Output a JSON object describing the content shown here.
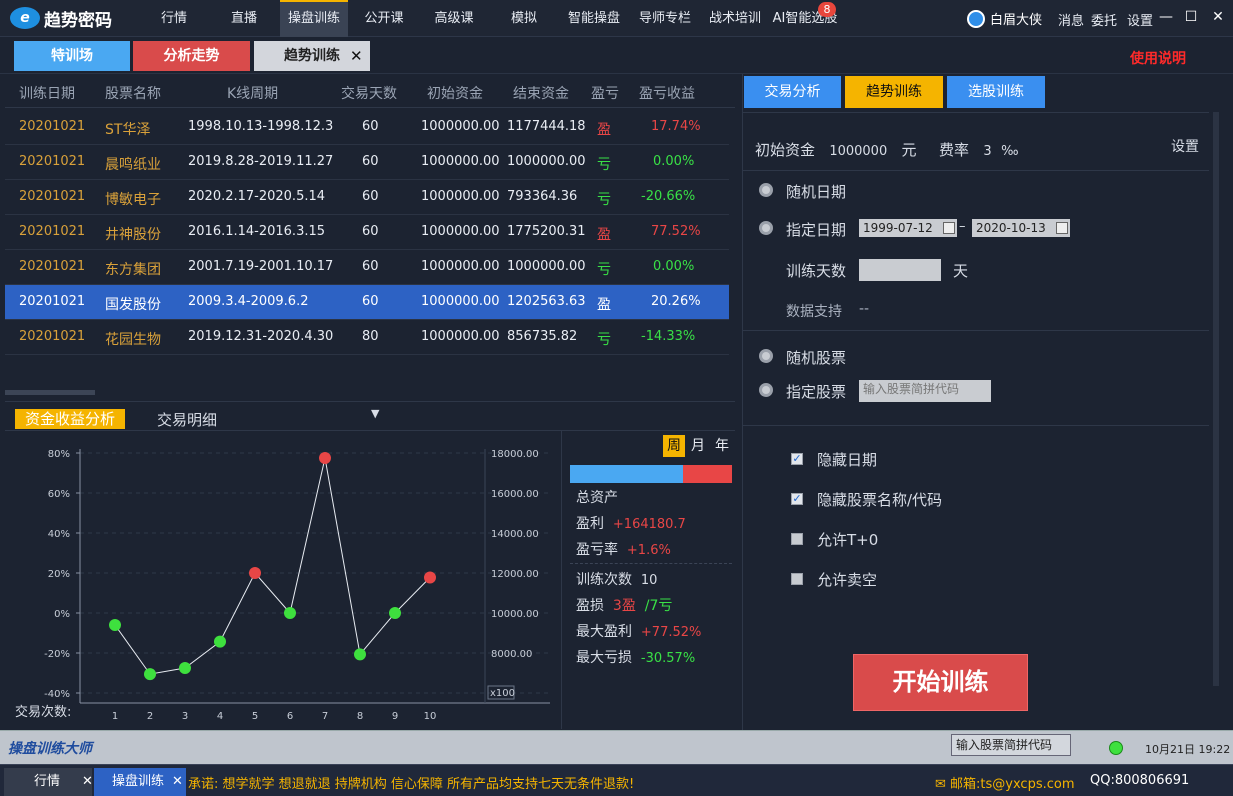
{
  "app": {
    "logo_text": "趋势密码",
    "logo_mark": "e"
  },
  "nav": [
    {
      "label": "行情"
    },
    {
      "label": "直播"
    },
    {
      "label": "操盘训练"
    },
    {
      "label": "公开课"
    },
    {
      "label": "高级课"
    },
    {
      "label": "模拟"
    },
    {
      "label": "智能操盘"
    },
    {
      "label": "导师专栏"
    },
    {
      "label": "战术培训"
    },
    {
      "label": "AI智能选股"
    }
  ],
  "nav_badge": "8",
  "user": {
    "name": "白眉大侠"
  },
  "top_links": {
    "msg": "消息",
    "entrust": "委托",
    "settings": "设置"
  },
  "window_controls": {
    "min": "—",
    "max": "☐",
    "close": "✕"
  },
  "main_tabs": {
    "tab1": "特训场",
    "tab2": "分析走势",
    "tab3": "趋势训练",
    "tab3_close": "✕"
  },
  "help_link": "使用说明",
  "table": {
    "headers": [
      "训练日期",
      "股票名称",
      "K线周期",
      "交易天数",
      "初始资金",
      "结束资金",
      "盈亏",
      "盈亏收益"
    ],
    "rows": [
      {
        "date": "20201021",
        "name": "ST华泽",
        "period": "1998.10.13-1998.12.3",
        "days": "60",
        "init": "1000000.00",
        "end": "1177444.18",
        "pl": "盈",
        "ret": "17.74%"
      },
      {
        "date": "20201021",
        "name": "晨鸣纸业",
        "period": "2019.8.28-2019.11.27",
        "days": "60",
        "init": "1000000.00",
        "end": "1000000.00",
        "pl": "亏",
        "ret": "0.00%"
      },
      {
        "date": "20201021",
        "name": "博敏电子",
        "period": "2020.2.17-2020.5.14",
        "days": "60",
        "init": "1000000.00",
        "end": "793364.36",
        "pl": "亏",
        "ret": "-20.66%"
      },
      {
        "date": "20201021",
        "name": "井神股份",
        "period": "2016.1.14-2016.3.15",
        "days": "60",
        "init": "1000000.00",
        "end": "1775200.31",
        "pl": "盈",
        "ret": "77.52%"
      },
      {
        "date": "20201021",
        "name": "东方集团",
        "period": "2001.7.19-2001.10.17",
        "days": "60",
        "init": "1000000.00",
        "end": "1000000.00",
        "pl": "亏",
        "ret": "0.00%"
      },
      {
        "date": "20201021",
        "name": "国发股份",
        "period": "2009.3.4-2009.6.2",
        "days": "60",
        "init": "1000000.00",
        "end": "1202563.63",
        "pl": "盈",
        "ret": "20.26%"
      },
      {
        "date": "20201021",
        "name": "花园生物",
        "period": "2019.12.31-2020.4.30",
        "days": "80",
        "init": "1000000.00",
        "end": "856735.82",
        "pl": "亏",
        "ret": "-14.33%"
      }
    ]
  },
  "subtabs": {
    "tab1": "资金收益分析",
    "tab2": "交易明细",
    "arrow": "▼"
  },
  "chart_data": {
    "type": "line",
    "xlabel": "交易次数:",
    "x": [
      1,
      2,
      3,
      4,
      5,
      6,
      7,
      8,
      9,
      10
    ],
    "series": [
      {
        "values": [
          -6,
          -30.57,
          -27.5,
          -14.33,
          20,
          0,
          77.52,
          -20.66,
          0,
          17.74
        ]
      }
    ],
    "y_left_ticks": [
      "80%",
      "60%",
      "40%",
      "20%",
      "0%",
      "-20%",
      "-40%"
    ],
    "y_right_ticks": [
      "18000.00",
      "16000.00",
      "14000.00",
      "12000.00",
      "10000.00",
      "8000.00"
    ],
    "right_unit": "x100",
    "ylim": [
      -40,
      80
    ],
    "colors": {
      "pos": "#e84646",
      "neg": "#3ee03e"
    }
  },
  "period_buttons": {
    "week": "周",
    "month": "月",
    "year": "年"
  },
  "stats": {
    "bar_win_fraction": 0.7,
    "total_assets": "总资产",
    "profit_label": "盈利",
    "profit": "+164180.7",
    "rate_label": "盈亏率",
    "rate": "+1.6%",
    "count_label": "训练次数",
    "count": "10",
    "wl_label": "盈损",
    "wins": "3盈",
    "losses": "/7亏",
    "max_profit_label": "最大盈利",
    "max_profit": "+77.52%",
    "max_loss_label": "最大亏损",
    "max_loss": "-30.57%"
  },
  "right_tabs": {
    "t1": "交易分析",
    "t2": "趋势训练",
    "t3": "选股训练"
  },
  "settings": {
    "capital_label": "初始资金",
    "capital": "1000000",
    "capital_unit": "元",
    "fee_label": "费率",
    "fee": "3",
    "fee_unit": "‰",
    "set": "设置",
    "random_date": "随机日期",
    "fixed_date": "指定日期",
    "date_from": "1999-07-12",
    "dash": "–",
    "date_to": "2020-10-13",
    "days_label": "训练天数",
    "days_unit": "天",
    "data_label": "数据支持",
    "data_value": "--",
    "random_stock": "随机股票",
    "fixed_stock": "指定股票",
    "stock_placeholder": "输入股票简拼代码",
    "hide_date": "隐藏日期",
    "hide_name": "隐藏股票名称/代码",
    "allow_t0": "允许T+0",
    "allow_short": "允许卖空",
    "start": "开始训练"
  },
  "status": {
    "logo": "操盘训练大师",
    "search": "输入股票简拼代码",
    "time": "10月21日 19:22"
  },
  "taskbar": {
    "tab1": "行情",
    "tab2": "操盘训练",
    "close": "✕",
    "ticker": "承诺: 想学就学 想退就退 持牌机构 信心保障 所有产品均支持七天无条件退款!",
    "mail": "✉ 邮箱:ts@yxcps.com",
    "qq": "QQ:800806691"
  }
}
